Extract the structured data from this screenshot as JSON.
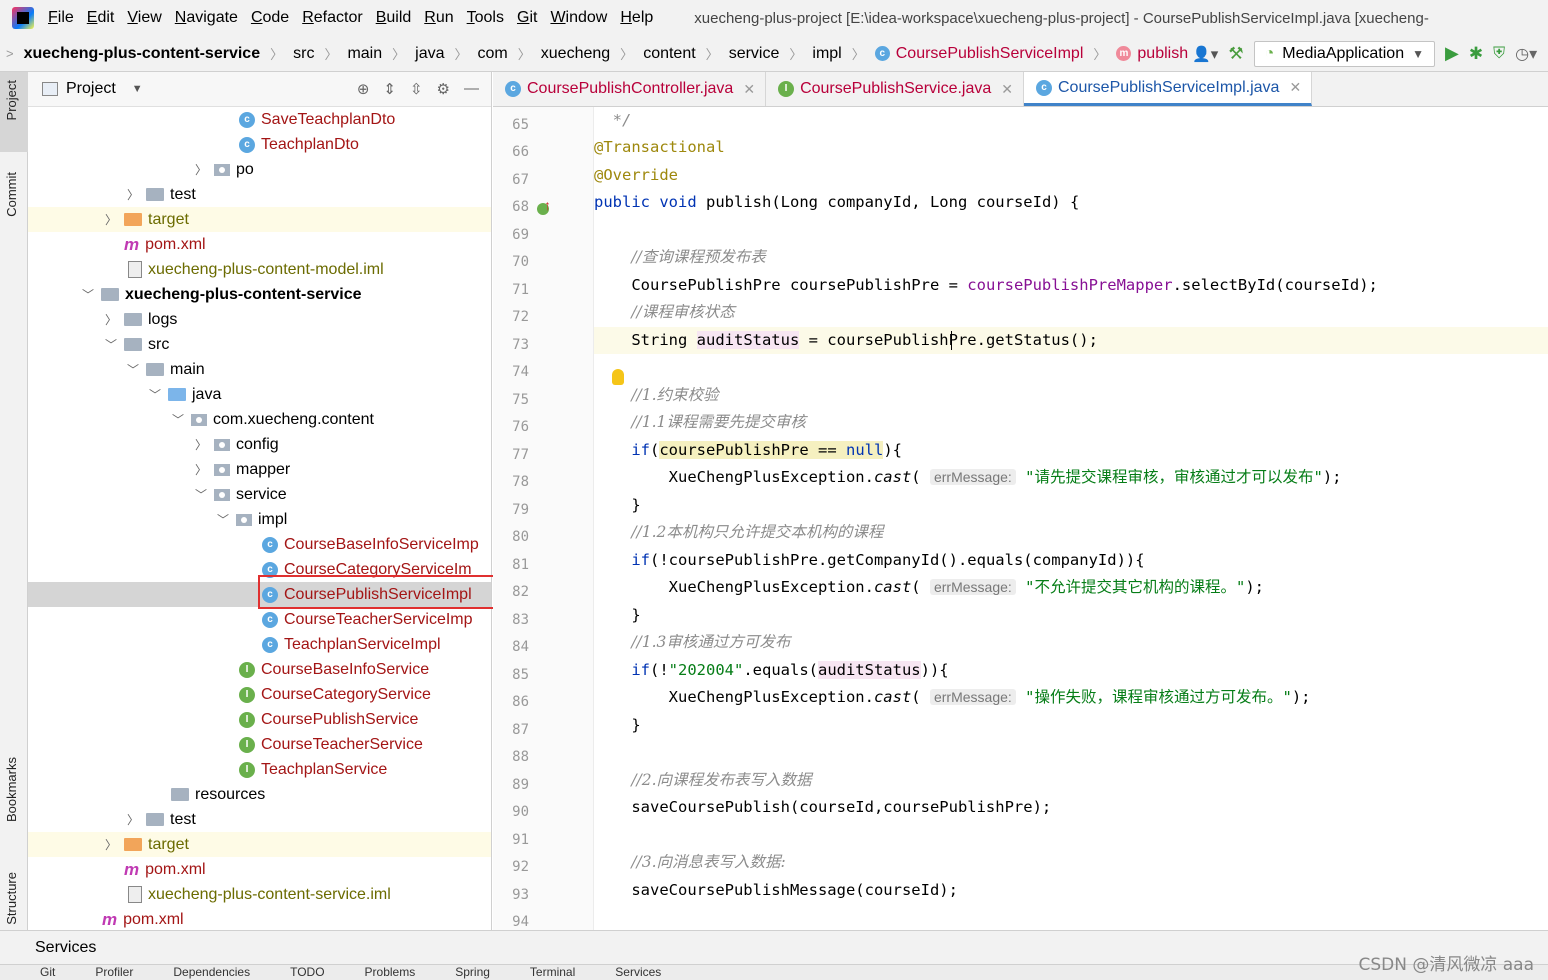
{
  "menubar": {
    "items": [
      "File",
      "Edit",
      "View",
      "Navigate",
      "Code",
      "Refactor",
      "Build",
      "Run",
      "Tools",
      "Git",
      "Window",
      "Help"
    ],
    "window_title": "xuecheng-plus-project [E:\\idea-workspace\\xuecheng-plus-project] - CoursePublishServiceImpl.java [xuecheng-"
  },
  "navbar": {
    "crumbs": [
      "xuecheng-plus-content-service",
      "src",
      "main",
      "java",
      "com",
      "xuecheng",
      "content",
      "service",
      "impl",
      "CoursePublishServiceImpl",
      "publish"
    ],
    "run_config": "MediaApplication"
  },
  "left_strip": {
    "project": "Project",
    "commit": "Commit",
    "bookmarks": "Bookmarks",
    "structure": "Structure"
  },
  "project_panel": {
    "title": "Project",
    "tree": [
      {
        "label": "SaveTeachplanDto",
        "icon": "class"
      },
      {
        "label": "TeachplanDto",
        "icon": "class"
      },
      {
        "label": "po",
        "icon": "package"
      },
      {
        "label": "test",
        "icon": "folder"
      },
      {
        "label": "target",
        "icon": "folder-orange"
      },
      {
        "label": "pom.xml",
        "icon": "maven"
      },
      {
        "label": "xuecheng-plus-content-model.iml",
        "icon": "iml"
      },
      {
        "label": "xuecheng-plus-content-service",
        "icon": "module"
      },
      {
        "label": "logs",
        "icon": "folder"
      },
      {
        "label": "src",
        "icon": "folder"
      },
      {
        "label": "main",
        "icon": "folder"
      },
      {
        "label": "java",
        "icon": "folder-blue"
      },
      {
        "label": "com.xuecheng.content",
        "icon": "package"
      },
      {
        "label": "config",
        "icon": "package"
      },
      {
        "label": "mapper",
        "icon": "package"
      },
      {
        "label": "service",
        "icon": "package"
      },
      {
        "label": "impl",
        "icon": "package"
      },
      {
        "label": "CourseBaseInfoServiceImp",
        "icon": "class"
      },
      {
        "label": "CourseCategoryServiceIm",
        "icon": "class"
      },
      {
        "label": "CoursePublishServiceImpl",
        "icon": "class"
      },
      {
        "label": "CourseTeacherServiceImp",
        "icon": "class"
      },
      {
        "label": "TeachplanServiceImpl",
        "icon": "class"
      },
      {
        "label": "CourseBaseInfoService",
        "icon": "interface"
      },
      {
        "label": "CourseCategoryService",
        "icon": "interface"
      },
      {
        "label": "CoursePublishService",
        "icon": "interface"
      },
      {
        "label": "CourseTeacherService",
        "icon": "interface"
      },
      {
        "label": "TeachplanService",
        "icon": "interface"
      },
      {
        "label": "resources",
        "icon": "folder"
      },
      {
        "label": "test",
        "icon": "folder"
      },
      {
        "label": "target",
        "icon": "folder-orange"
      },
      {
        "label": "pom.xml",
        "icon": "maven"
      },
      {
        "label": "xuecheng-plus-content-service.iml",
        "icon": "iml"
      },
      {
        "label": "pom.xml",
        "icon": "maven"
      }
    ]
  },
  "editor": {
    "tabs": [
      {
        "label": "CoursePublishController.java",
        "icon": "class"
      },
      {
        "label": "CoursePublishService.java",
        "icon": "interface"
      },
      {
        "label": "CoursePublishServiceImpl.java",
        "icon": "class",
        "active": true
      }
    ],
    "line_numbers": [
      "65",
      "66",
      "67",
      "68",
      "69",
      "70",
      "71",
      "72",
      "73",
      "74",
      "75",
      "76",
      "77",
      "78",
      "79",
      "80",
      "81",
      "82",
      "83",
      "84",
      "85",
      "86",
      "87",
      "88",
      "89",
      "90",
      "91",
      "92",
      "93",
      "94"
    ],
    "code": {
      "l65": "*/",
      "l66": "@Transactional",
      "l67": "@Override",
      "l68_kw1": "public",
      "l68_kw2": "void",
      "l68_rest": " publish(Long companyId, Long courseId) {",
      "l70": "//查询课程预发布表",
      "l71_a": "CoursePublishPre coursePublishPre = ",
      "l71_f": "coursePublishPreMapper",
      "l71_b": ".selectById(courseId);",
      "l72": "//课程审核状态",
      "l73_a": "String ",
      "l73_v": "auditStatus",
      "l73_b": " = coursePublishPre.getStatus();",
      "l75": "//1.约束校验",
      "l76": "//1.1课程需要先提交审核",
      "l77_kw": "if",
      "l77_a": "(",
      "l77_h": "coursePublishPre == ",
      "l77_n": "null",
      "l77_b": "){",
      "l78_a": "XueChengPlusException.",
      "l78_m": "cast",
      "l78_p": "(",
      "l78_hint": "errMessage:",
      "l78_s": "\"请先提交课程审核，审核通过才可以发布\"",
      "l78_e": ");",
      "l79": "}",
      "l80": "//1.2本机构只允许提交本机构的课程",
      "l81_kw": "if",
      "l81_a": "(!coursePublishPre.getCompanyId().equals(companyId)){",
      "l82_a": "XueChengPlusException.",
      "l82_m": "cast",
      "l82_p": "(",
      "l82_hint": "errMessage:",
      "l82_s": "\"不允许提交其它机构的课程。\"",
      "l82_e": ");",
      "l83": "}",
      "l84": "//1.3审核通过方可发布",
      "l85_kw": "if",
      "l85_a": "(!",
      "l85_s": "\"202004\"",
      "l85_b": ".equals(",
      "l85_v": "auditStatus",
      "l85_c": ")){",
      "l86_a": "XueChengPlusException.",
      "l86_m": "cast",
      "l86_p": "(",
      "l86_hint": "errMessage:",
      "l86_s": "\"操作失败，课程审核通过方可发布。\"",
      "l86_e": ");",
      "l87": "}",
      "l89": "//2.向课程发布表写入数据",
      "l90": "saveCoursePublish(courseId,coursePublishPre);",
      "l92": "//3.向消息表写入数据:",
      "l93": "saveCoursePublishMessage(courseId);"
    }
  },
  "bottom": {
    "services": "Services",
    "strip": [
      "Git",
      "Profiler",
      "Dependencies",
      "TODO",
      "Problems",
      "Spring",
      "Terminal",
      "Services"
    ]
  },
  "watermark": "CSDN @清风微凉 aaa",
  "colors": {
    "keyword": "#0033b3",
    "annotation": "#9e880d",
    "comment": "#8c8c8c",
    "field": "#871094",
    "string": "#067d17",
    "highlight_box": "#e03030"
  }
}
